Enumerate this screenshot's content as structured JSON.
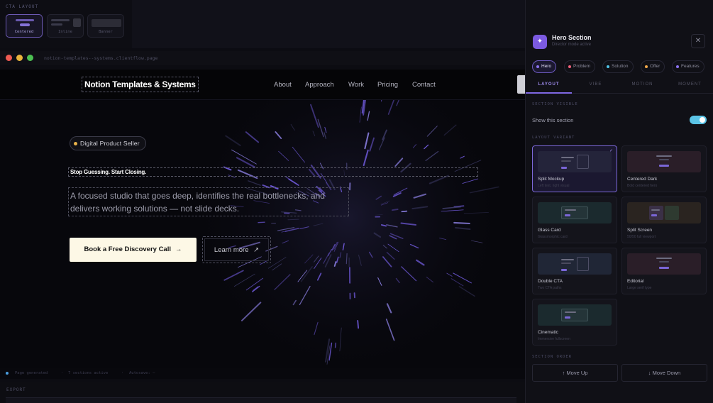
{
  "cta_layout": {
    "title": "CTA LAYOUT",
    "options": [
      {
        "label": "Centered",
        "active": true
      },
      {
        "label": "Inline",
        "active": false
      },
      {
        "label": "Banner",
        "active": false
      }
    ]
  },
  "browser": {
    "url": "notion-templates--systems.clientflow.page"
  },
  "nav": {
    "brand": "Notion Templates & Systems",
    "links": [
      "About",
      "Approach",
      "Work",
      "Pricing",
      "Contact"
    ]
  },
  "hero": {
    "badge": "Digital Product Seller",
    "headline": "Stop Guessing. Start Closing.",
    "subhead": "A focused studio that goes deep, identifies the real bottlenecks, and delivers working solutions — not slide decks.",
    "primary_cta": "Book a Free Discovery Call",
    "primary_icon": "arrow-right-icon",
    "secondary_cta": "Learn more",
    "secondary_icon": "arrow-up-right-icon"
  },
  "status_bar": {
    "items": [
      "Page generated",
      "7 sections active",
      "Autosave: —"
    ]
  },
  "export": {
    "label": "EXPORT"
  },
  "panel": {
    "title": "Hero Section",
    "subtitle": "Director mode active",
    "section_tabs": [
      {
        "label": "Hero",
        "color": "#8b72f0",
        "active": true
      },
      {
        "label": "Problem",
        "color": "#f0607a",
        "active": false
      },
      {
        "label": "Solution",
        "color": "#4fc3e8",
        "active": false
      },
      {
        "label": "Offer",
        "color": "#f0a84a",
        "active": false
      },
      {
        "label": "Features",
        "color": "#8b72f0",
        "active": false
      }
    ],
    "sub_tabs": [
      {
        "label": "LAYOUT",
        "active": true
      },
      {
        "label": "VIBE",
        "active": false
      },
      {
        "label": "MOTION",
        "active": false
      },
      {
        "label": "MOMENT",
        "active": false
      }
    ],
    "section_visible": {
      "heading": "SECTION VISIBLE",
      "label": "Show this section",
      "on": true
    },
    "layout_variant": {
      "heading": "LAYOUT VARIANT",
      "variants": [
        {
          "name": "Split Mockup",
          "desc": "Left text, right visual",
          "selected": true
        },
        {
          "name": "Centered Dark",
          "desc": "Bold centered hero",
          "selected": false
        },
        {
          "name": "Glass Card",
          "desc": "Glassmorphic card",
          "selected": false
        },
        {
          "name": "Split Screen",
          "desc": "50/50 full viewport",
          "selected": false
        },
        {
          "name": "Double CTA",
          "desc": "Two CTA paths",
          "selected": false
        },
        {
          "name": "Editorial",
          "desc": "Large serif type",
          "selected": false
        },
        {
          "name": "Cinematic",
          "desc": "Immersive fullscreen",
          "selected": false
        }
      ]
    },
    "section_order": {
      "heading": "SECTION ORDER",
      "move_up": "↑ Move Up",
      "move_down": "↓ Move Down"
    }
  }
}
